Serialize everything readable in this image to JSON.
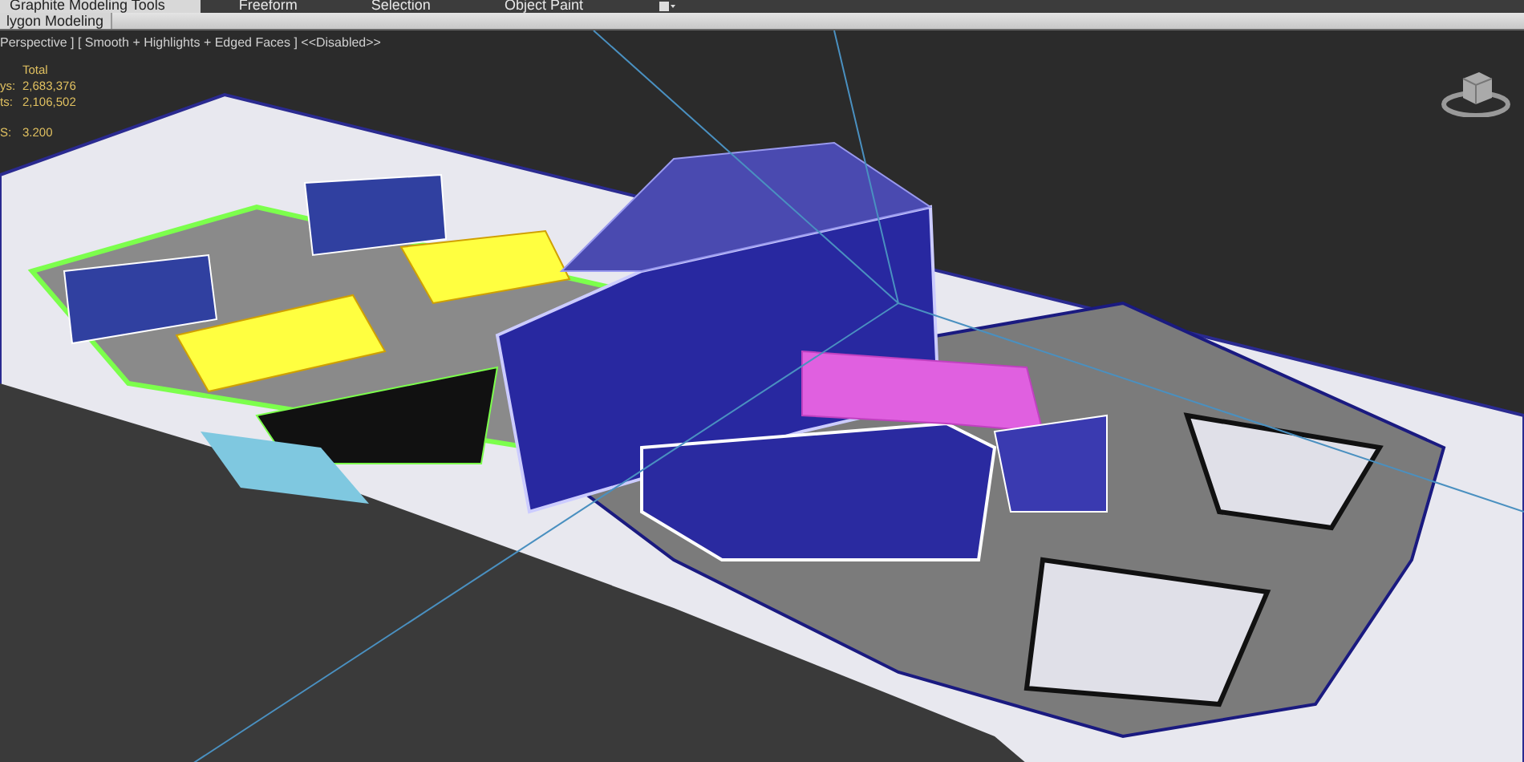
{
  "ribbon": {
    "tabs": [
      {
        "label": "Graphite Modeling Tools",
        "selected": true
      },
      {
        "label": "Freeform",
        "selected": false
      },
      {
        "label": "Selection",
        "selected": false
      },
      {
        "label": "Object Paint",
        "selected": false
      }
    ]
  },
  "panel": {
    "label": "lygon Modeling"
  },
  "viewport": {
    "label": "Perspective ] [ Smooth + Highlights + Edged Faces ] <<Disabled>>",
    "stats": {
      "header": "Total",
      "rows": [
        {
          "label": "ys:",
          "value": "2,683,376"
        },
        {
          "label": "ts:",
          "value": "2,106,502"
        },
        {
          "label": "S:",
          "value": "3.200"
        }
      ]
    }
  }
}
